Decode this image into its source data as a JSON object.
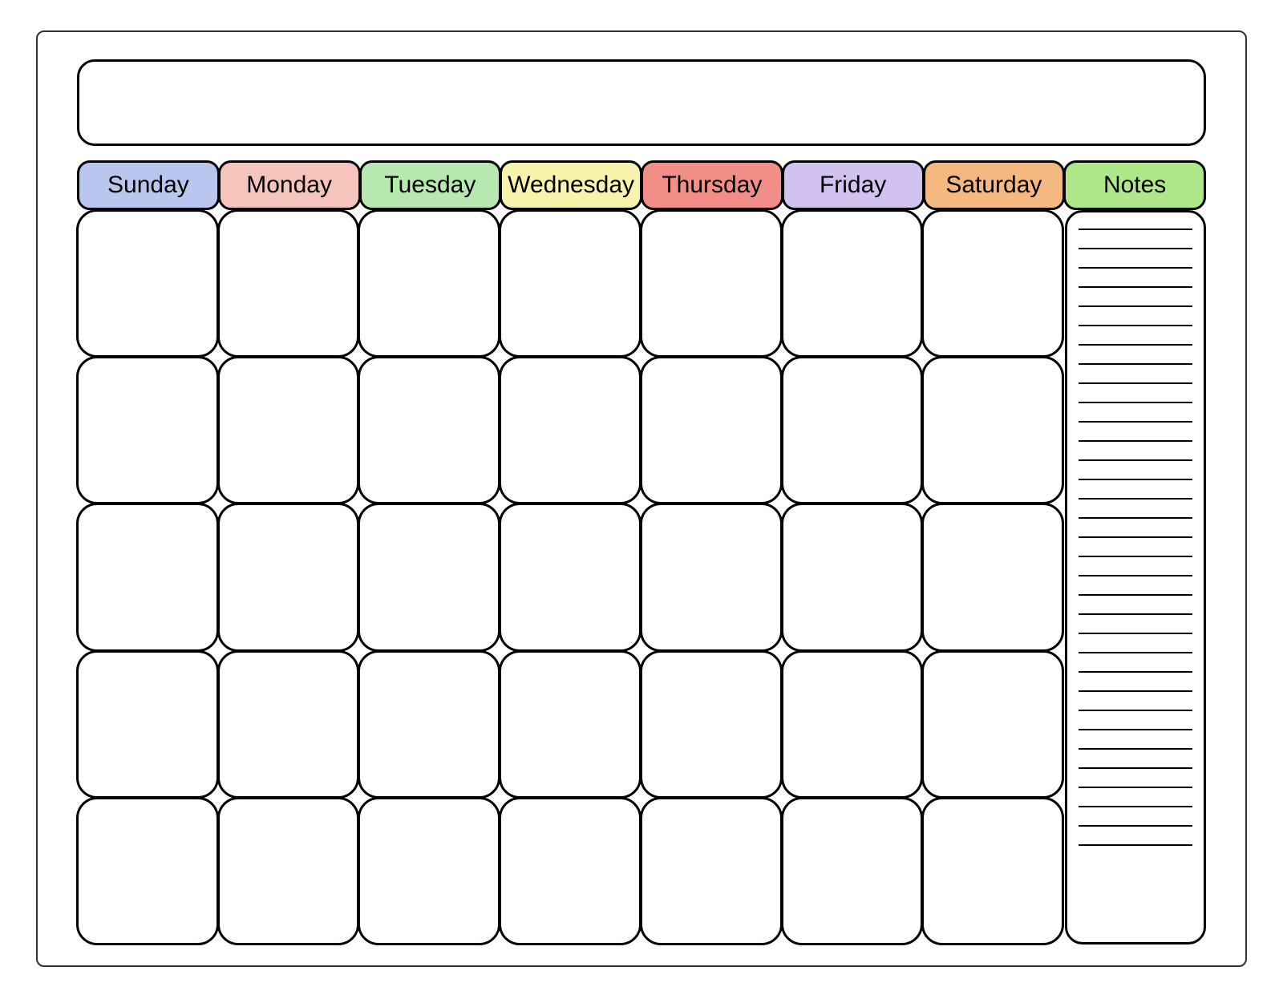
{
  "header": {
    "days": [
      {
        "label": "Sunday",
        "color": "#b9c7ee"
      },
      {
        "label": "Monday",
        "color": "#f5c4bd"
      },
      {
        "label": "Tuesday",
        "color": "#b6e8b0"
      },
      {
        "label": "Wednesday",
        "color": "#f7f2ac"
      },
      {
        "label": "Thursday",
        "color": "#f08e87"
      },
      {
        "label": "Friday",
        "color": "#d2c2f0"
      },
      {
        "label": "Saturday",
        "color": "#f4b880"
      }
    ],
    "notes": {
      "label": "Notes",
      "color": "#aee88a"
    }
  },
  "grid": {
    "rows": 5,
    "cols": 7
  },
  "notes": {
    "line_count": 33
  }
}
